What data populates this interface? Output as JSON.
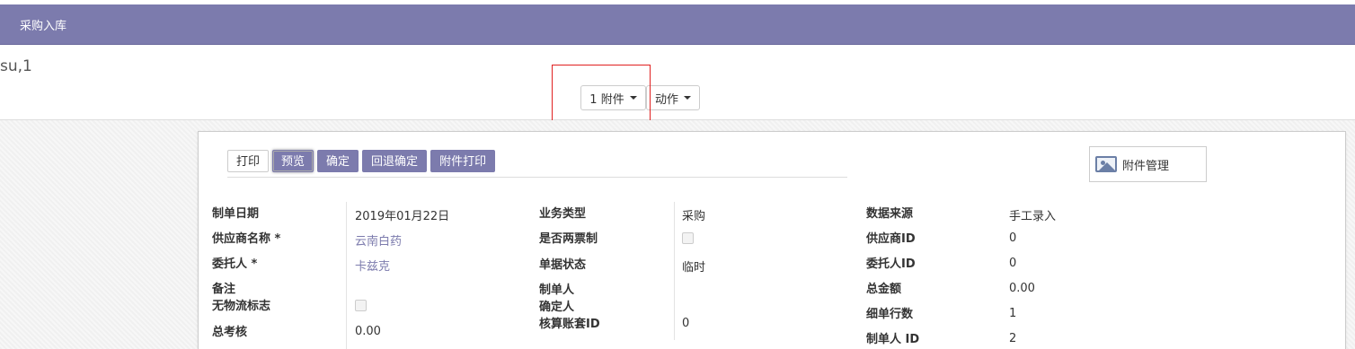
{
  "topbar": {
    "title": "采购入库"
  },
  "breadcrumb": "su,1",
  "toolbar": {
    "attachments_label": "1 附件",
    "actions_label": "动作"
  },
  "form_buttons": {
    "print": "打印",
    "preview": "预览",
    "confirm": "确定",
    "revert_confirm": "回退确定",
    "attachment_print": "附件打印"
  },
  "attachment_manage": "附件管理",
  "col1": {
    "date_label": "制单日期",
    "date_value": "2019年01月22日",
    "supplier_label": "供应商名称 *",
    "supplier_value": "云南白药",
    "consignor_label": "委托人 *",
    "consignor_value": "卡兹克",
    "remark_label": "备注",
    "no_logistics_label": "无物流标志",
    "total_check_label": "总考核",
    "total_check_value": "0.00"
  },
  "col2": {
    "business_type_label": "业务类型",
    "business_type_value": "采购",
    "two_invoice_label": "是否两票制",
    "doc_status_label": "单据状态",
    "doc_status_value": "临时",
    "maker_label": "制单人",
    "confirmer_label": "确定人",
    "account_set_label": "核算账套ID",
    "account_set_value": "0"
  },
  "col3": {
    "data_source_label": "数据来源",
    "data_source_value": "手工录入",
    "supplier_id_label": "供应商ID",
    "supplier_id_value": "0",
    "consignor_id_label": "委托人ID",
    "consignor_id_value": "0",
    "total_amount_label": "总金额",
    "total_amount_value": "0.00",
    "detail_rows_label": "细单行数",
    "detail_rows_value": "1",
    "maker_id_label": "制单人 ID",
    "maker_id_value": "2"
  }
}
